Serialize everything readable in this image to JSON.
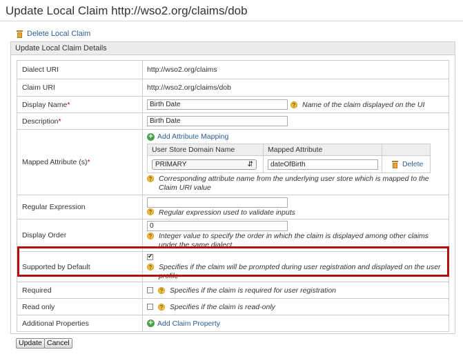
{
  "header": {
    "title": "Update Local Claim http://wso2.org/claims/dob"
  },
  "actions": {
    "delete_local_claim": "Delete Local Claim"
  },
  "panel": {
    "title": "Update Local Claim Details"
  },
  "form": {
    "dialect_uri": {
      "label": "Dialect URI",
      "value": "http://wso2.org/claims"
    },
    "claim_uri": {
      "label": "Claim URI",
      "value": "http://wso2.org/claims/dob"
    },
    "display_name": {
      "label": "Display Name",
      "required_mark": "*",
      "value": "Birth Date",
      "hint": "Name of the claim displayed on the UI"
    },
    "description": {
      "label": "Description",
      "required_mark": "*",
      "value": "Birth Date"
    },
    "mapped_attribute": {
      "label": "Mapped Attribute (s)",
      "required_mark": "*",
      "add_link": "Add Attribute Mapping",
      "columns": [
        "User Store Domain Name",
        "Mapped Attribute"
      ],
      "rows": [
        {
          "domain": "PRIMARY",
          "attribute": "dateOfBirth",
          "delete_label": "Delete"
        }
      ],
      "hint": "Corresponding attribute name from the underlying user store which is mapped to the Claim URI value"
    },
    "regex": {
      "label": "Regular Expression",
      "value": "",
      "hint": "Regular expression used to validate inputs"
    },
    "display_order": {
      "label": "Display Order",
      "value": "0",
      "hint": "Integer value to specify the order in which the claim is displayed among other claims under the same dialect"
    },
    "supported_by_default": {
      "label": "Supported by Default",
      "checked": true,
      "hint": "Specifies if the claim will be prompted during user registration and displayed on the user profile"
    },
    "required": {
      "label": "Required",
      "checked": false,
      "hint": "Specifies if the claim is required for user registration"
    },
    "read_only": {
      "label": "Read only",
      "checked": false,
      "hint": "Specifies if the claim is read-only"
    },
    "additional_properties": {
      "label": "Additional Properties",
      "add_link": "Add Claim Property"
    }
  },
  "buttons": {
    "update": "Update",
    "cancel": "Cancel"
  },
  "colors": {
    "link": "#2c5c97",
    "highlight": "#b50e0e",
    "required": "#cc0000"
  }
}
